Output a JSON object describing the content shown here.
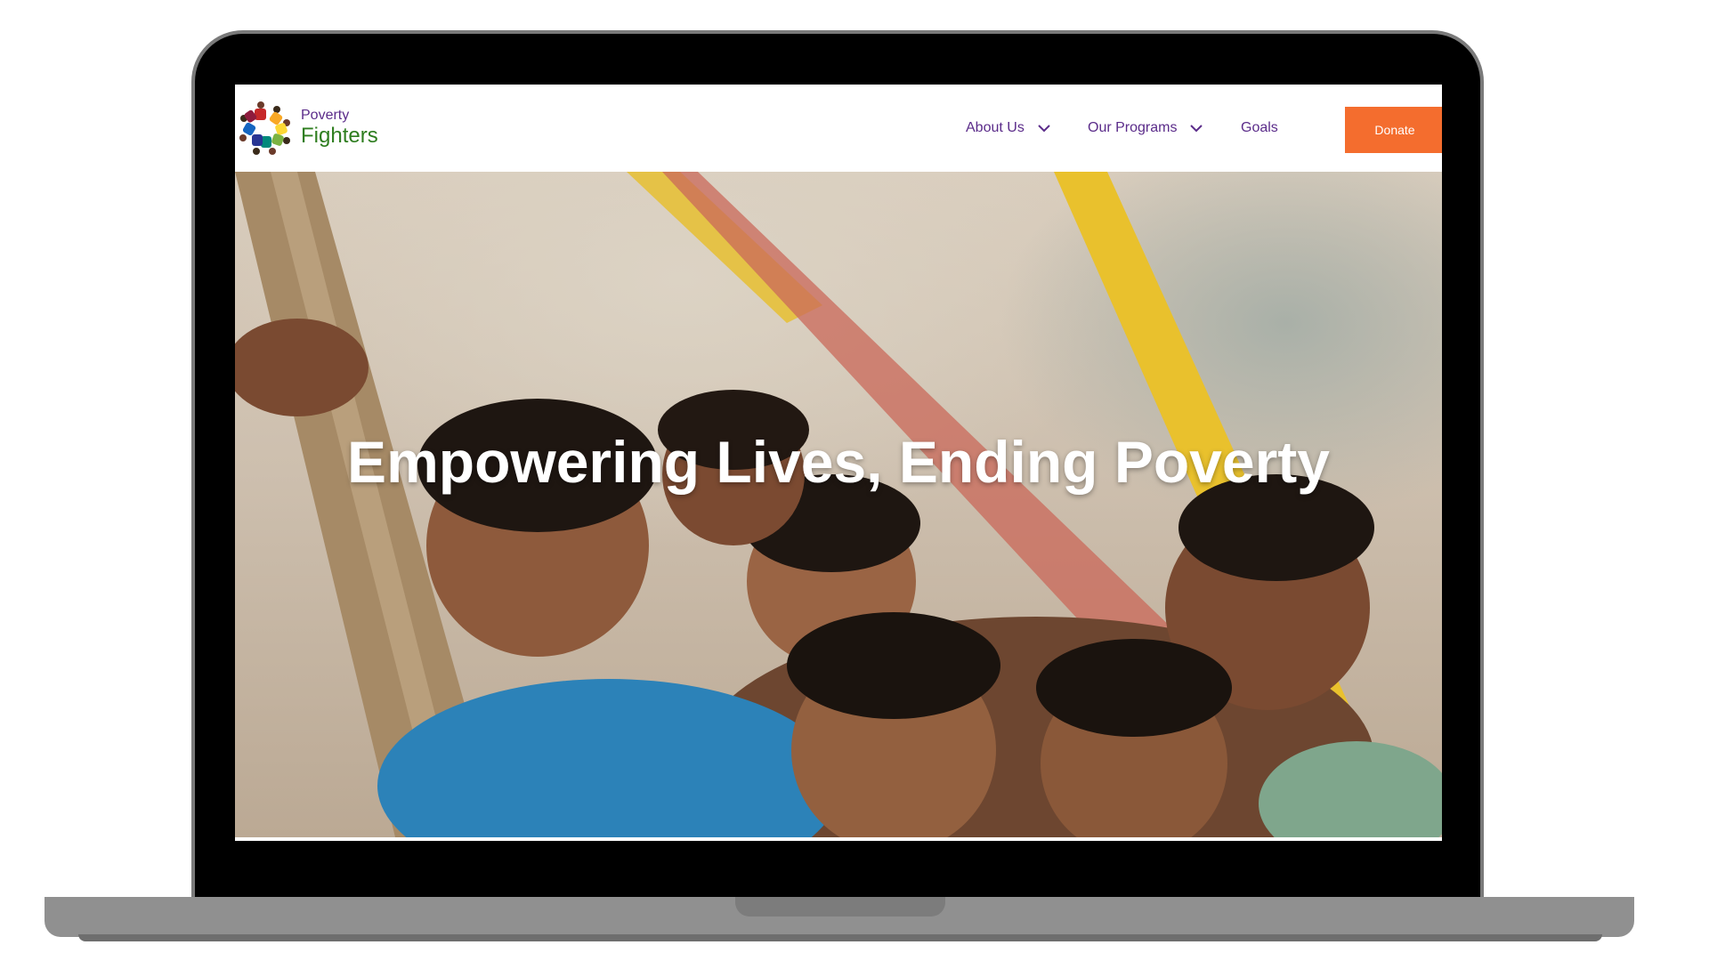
{
  "brand": {
    "name_top": "Poverty",
    "name_bottom": "Fighters",
    "logo_icon": "people-circle-logo-icon"
  },
  "nav": {
    "items": [
      {
        "label": "About Us",
        "has_dropdown": true
      },
      {
        "label": "Our Programs",
        "has_dropdown": true
      },
      {
        "label": "Goals",
        "has_dropdown": false
      }
    ],
    "donate_label": "Donate"
  },
  "hero": {
    "title": "Empowering Lives, Ending Poverty",
    "image_subject": "group of smiling children"
  },
  "colors": {
    "brand_purple": "#5b2c8a",
    "brand_green": "#2e7d1f",
    "donate_orange": "#f46d2e"
  }
}
